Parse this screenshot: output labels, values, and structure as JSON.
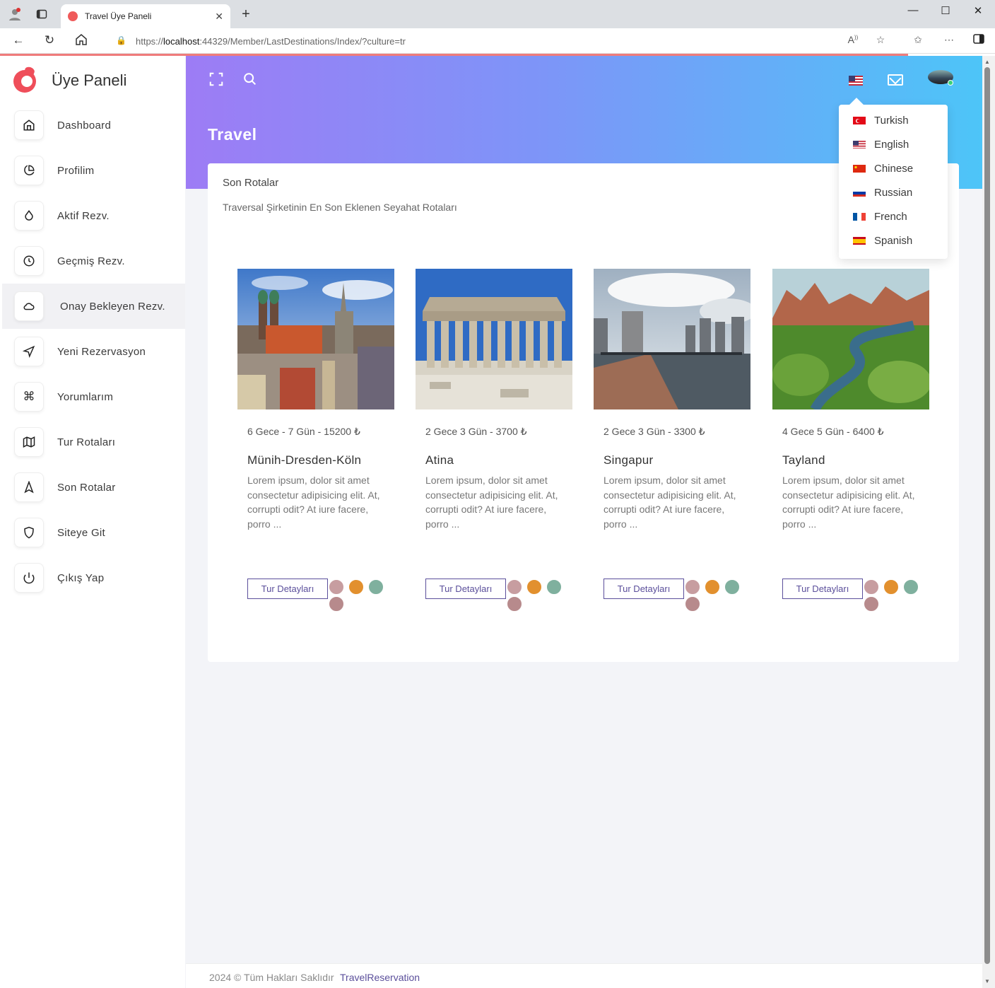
{
  "browser": {
    "tab_title": "Travel Üye Paneli",
    "url_prefix": "https://",
    "url_host": "localhost",
    "url_rest": ":44329/Member/LastDestinations/Index/?culture=tr"
  },
  "sidebar": {
    "brand": "Üye Paneli",
    "items": [
      {
        "label": "Dashboard",
        "icon": "home-icon"
      },
      {
        "label": "Profilim",
        "icon": "pie-chart-icon"
      },
      {
        "label": "Aktif Rezv.",
        "icon": "droplet-icon"
      },
      {
        "label": "Geçmiş Rezv.",
        "icon": "clock-icon"
      },
      {
        "label": "Onay Bekleyen Rezv.",
        "icon": "cloud-icon"
      },
      {
        "label": "Yeni Rezervasyon",
        "icon": "navigation-icon"
      },
      {
        "label": "Yorumlarım",
        "icon": "command-icon"
      },
      {
        "label": "Tur Rotaları",
        "icon": "map-icon"
      },
      {
        "label": "Son Rotalar",
        "icon": "navigation-2-icon"
      },
      {
        "label": "Siteye Git",
        "icon": "shield-icon"
      },
      {
        "label": "Çıkış Yap",
        "icon": "power-icon"
      }
    ],
    "active_index": 4
  },
  "header": {
    "title": "Travel"
  },
  "card": {
    "title": "Son Rotalar",
    "subtitle": "Traversal Şirketinin En Son Eklenen Seyahat Rotaları"
  },
  "destinations": [
    {
      "meta": "6 Gece - 7 Gün - 15200 ₺",
      "name": "Münih-Dresden-Köln",
      "desc": "Lorem ipsum, dolor sit amet consectetur adipisicing elit. At, corrupti odit? At iure facere, porro ...",
      "button": "Tur Detayları"
    },
    {
      "meta": "2 Gece 3 Gün - 3700 ₺",
      "name": "Atina",
      "desc": "Lorem ipsum, dolor sit amet consectetur adipisicing elit. At, corrupti odit? At iure facere, porro ...",
      "button": "Tur Detayları"
    },
    {
      "meta": "2 Gece 3 Gün - 3300 ₺",
      "name": "Singapur",
      "desc": "Lorem ipsum, dolor sit amet consectetur adipisicing elit. At, corrupti odit? At iure facere, porro ...",
      "button": "Tur Detayları"
    },
    {
      "meta": "4 Gece 5 Gün - 6400 ₺",
      "name": "Tayland",
      "desc": "Lorem ipsum, dolor sit amet consectetur adipisicing elit. At, corrupti odit? At iure facere, porro ...",
      "button": "Tur Detayları"
    }
  ],
  "languages": [
    {
      "label": "Turkish",
      "flag": "tr"
    },
    {
      "label": "English",
      "flag": "us"
    },
    {
      "label": "Chinese",
      "flag": "cn"
    },
    {
      "label": "Russian",
      "flag": "ru"
    },
    {
      "label": "French",
      "flag": "fr"
    },
    {
      "label": "Spanish",
      "flag": "es"
    }
  ],
  "footer": {
    "text": "2024 © Tüm Hakları Saklıdır",
    "link": "TravelReservation"
  },
  "colors": {
    "accent": "#5b4f9b",
    "banner_start": "#9d7cf5",
    "banner_end": "#4dc5f8",
    "brand_logo": "#ef4e5a"
  }
}
